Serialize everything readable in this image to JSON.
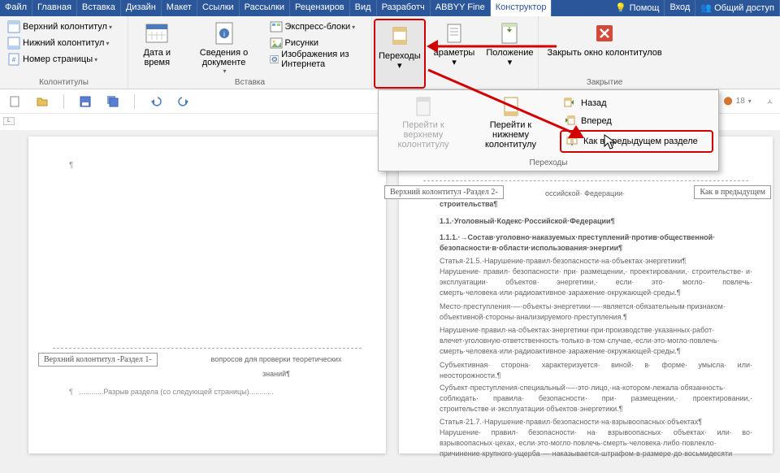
{
  "tabs": {
    "file": "Файл",
    "home": "Главная",
    "insert": "Вставка",
    "design": "Дизайн",
    "layout": "Макет",
    "references": "Ссылки",
    "mailings": "Рассылки",
    "review": "Рецензиров",
    "view": "Вид",
    "developer": "Разработч",
    "abbyy": "ABBYY Fine",
    "designer": "Конструктор",
    "help": "Помощ",
    "signin": "Вход",
    "share": "Общий доступ"
  },
  "ribbon": {
    "hf_group": {
      "header": "Верхний колонтитул",
      "footer": "Нижний колонтитул",
      "pagenum": "Номер страницы",
      "label": "Колонтитулы"
    },
    "insert_group": {
      "date": "Дата и время",
      "docinfo": "Сведения о документе",
      "quickparts": "Экспресс-блоки",
      "pictures": "Рисунки",
      "online": "Изображения из Интернета",
      "label": "Вставка"
    },
    "nav_group": {
      "transitions": "Переходы",
      "parameters": "араметры",
      "position": "Положение"
    },
    "close_group": {
      "close": "Закрыть окно колонтитулов",
      "label": "Закрытие"
    }
  },
  "dropdown": {
    "goto_header": "Перейти к верхнему колонтитулу",
    "goto_footer": "Перейти к нижнему колонтитулу",
    "back": "Назад",
    "forward": "Вперед",
    "same_as_prev": "Как в предыдущем разделе",
    "footer_label": "Переходы"
  },
  "qat_info": "18",
  "ruler_corner": "L",
  "doc": {
    "page1": {
      "hf_label": "Верхний колонтитул -Раздел 1-",
      "body1": "вопросов для проверки теоретических",
      "body2": "знаний¶",
      "break": "Разрыв раздела (со следующей страницы)"
    },
    "page2": {
      "hf_label": "Верхний колонтитул -Раздел 2-",
      "same_prev": "Как в предыдущем",
      "line_frag": "оссийской·  Федерации·",
      "subtitle": "строительства¶",
      "h1": "1.1.·Уголовный·Кодекс·Российской·Федерации¶",
      "p1": "1.1.1.·→Состав·уголовно·наказуемых·преступлений·против·общественной· безопасности·в·области·использования·энергии¶",
      "p2": "Статья·21.5.·Нарушение·правил·безопасности·на·объектах·энергетики¶",
      "p3": "Нарушение· правил· безопасности· при· размещении,· проектировании,· строительстве· и· эксплуатации· объектов· энергетики,· если· это· могло· повлечь· смерть·человека·или·радиоактивное·заражение·окружающей·среды.¶",
      "p4": "Место·преступления·—·объекты·энергетики·—·является·обязательным·признаком· объективной·стороны·анализируемого·преступления.¶",
      "p5": "Нарушение·правил·на·объектах·энергетики·при·производстве·указанных·работ· влечет·уголовную·ответственность·только·в·том·случае,·если·это·могло·повлечь· смерть·человека·или·радиоактивное·заражение·окружающей·среды.¶",
      "p6": "Субъективная· сторона· характеризуется· виной· в· форме· умысла· или· неосторожности.¶",
      "p7": "Субъект·преступления·специальный·—·это·лицо,·на·котором·лежала·обязанность· соблюдать· правила· безопасности· при· размещении,· проектировании,· строительстве·и·эксплуатации·объектов·энергетики.¶",
      "p8": "Статья·21.7.·Нарушение·правил·безопасности·на·взрывоопасных·объектах¶",
      "p9": "Нарушение· правил· безопасности· на· взрывоопасных· объектах· или· во· взрывоопасных·цехах,·если·это·могло·повлечь·смерть·человека·либо·повлекло· причинение·крупного·ущерба·—·наказывается·штрафом·в·размере·до·восьмидесяти"
    }
  }
}
